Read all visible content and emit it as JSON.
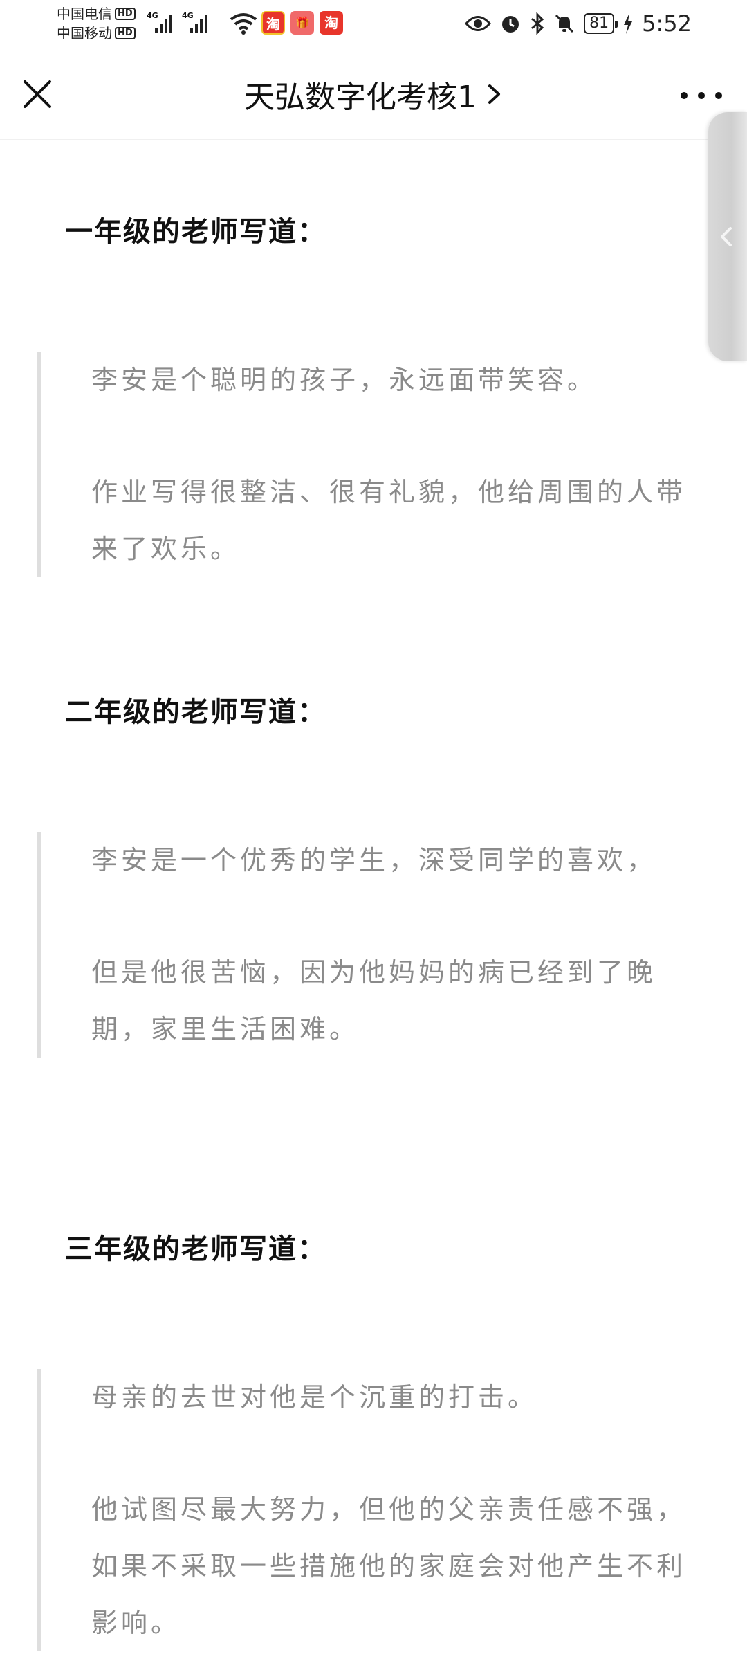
{
  "status_bar": {
    "carrier_1": "中国电信",
    "carrier_2": "中国移动",
    "hd_label": "HD",
    "network_1": "4G",
    "network_2": "4G",
    "app_badge_1": "淘",
    "app_badge_3": "淘",
    "battery": "81",
    "time": "5:52"
  },
  "nav": {
    "title": "天弘数字化考核1"
  },
  "sections": [
    {
      "heading": "一年级的老师写道：",
      "paragraphs": [
        "李安是个聪明的孩子，永远面带笑容。",
        "作业写得很整洁、很有礼貌，他给周围的人带来了欢乐。"
      ]
    },
    {
      "heading": "二年级的老师写道：",
      "paragraphs": [
        "李安是一个优秀的学生，深受同学的喜欢，",
        "但是他很苦恼，因为他妈妈的病已经到了晚期，家里生活困难。"
      ]
    },
    {
      "heading": "三年级的老师写道：",
      "paragraphs": [
        "母亲的去世对他是个沉重的打击。",
        "他试图尽最大努力，但他的父亲责任感不强，如果不采取一些措施他的家庭会对他产生不利影响。"
      ]
    }
  ]
}
